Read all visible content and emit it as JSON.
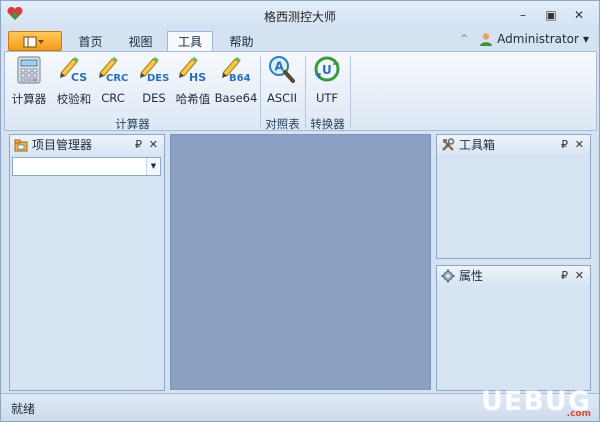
{
  "window": {
    "title": "格西测控大师",
    "minimize": "–",
    "restore": "▣",
    "close": "✕"
  },
  "tabs": [
    "首页",
    "视图",
    "工具",
    "帮助"
  ],
  "active_tab": "工具",
  "user": {
    "name": "Administrator",
    "arrow": "▾",
    "collapse": "⌃"
  },
  "ribbon": {
    "buttons": [
      {
        "label": "计算器",
        "icon": "calculator-icon"
      },
      {
        "label": "校验和",
        "icon": "cs-pencil-icon",
        "tag": "CS"
      },
      {
        "label": "CRC",
        "icon": "crc-pencil-icon",
        "tag": "CRC"
      },
      {
        "label": "DES",
        "icon": "des-pencil-icon",
        "tag": "DES"
      },
      {
        "label": "哈希值",
        "icon": "hs-pencil-icon",
        "tag": "HS"
      },
      {
        "label": "Base64",
        "icon": "b64-pencil-icon",
        "tag": "B64"
      },
      {
        "label": "ASCII",
        "icon": "ascii-magnifier-icon",
        "tag": "A"
      },
      {
        "label": "UTF",
        "icon": "utf-converter-icon",
        "tag": "U"
      }
    ],
    "groups": [
      "计算器",
      "对照表",
      "转换器"
    ]
  },
  "panels": {
    "project": {
      "title": "项目管理器",
      "pin": "₽",
      "close": "✕"
    },
    "toolbox": {
      "title": "工具箱",
      "pin": "₽",
      "close": "✕"
    },
    "properties": {
      "title": "属性",
      "pin": "₽",
      "close": "✕"
    }
  },
  "status": {
    "text": "就绪"
  },
  "watermark": {
    "text": "UEBUG",
    "sub": ".com"
  },
  "colors": {
    "accent": "#f29b1c",
    "canvas": "#8ba0c2",
    "ribbon_bg": "#f6f9fd"
  }
}
